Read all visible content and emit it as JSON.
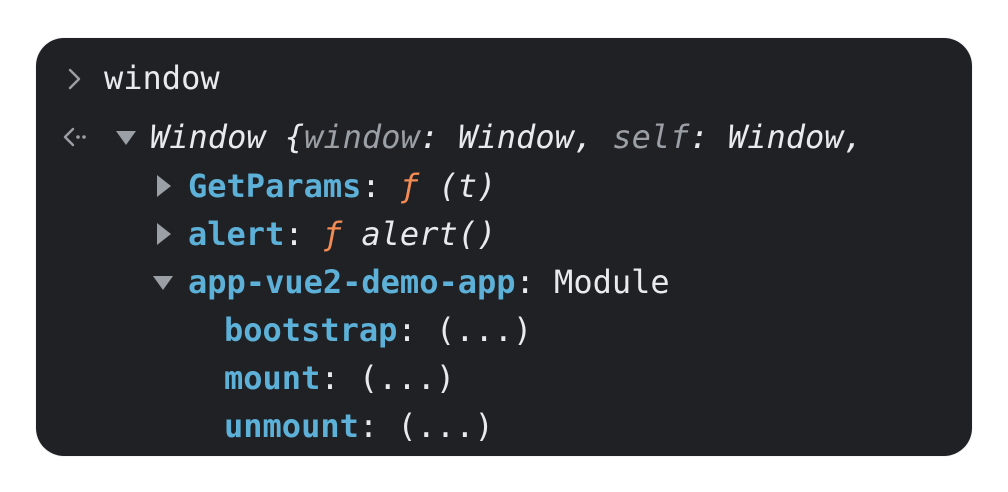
{
  "console": {
    "input": {
      "text": "window",
      "prompt_icon": "chevron-right-icon"
    },
    "result": {
      "result_icon": "return-arrow-icon",
      "expand_icon": "triangle-down-icon",
      "summary": {
        "prefix": "Window {",
        "k1": "window",
        "v1": ": Window, ",
        "k2": "self",
        "v2": ": Window,"
      }
    },
    "properties": [
      {
        "key": "GetParams",
        "sep": ": ",
        "fn": "ƒ",
        "value": " (t)",
        "expanded": false
      },
      {
        "key": "alert",
        "sep": ": ",
        "fn": "ƒ",
        "value": " alert()",
        "expanded": false
      },
      {
        "key": "app-vue2-demo-app",
        "sep": ": ",
        "value": "Module",
        "expanded": true
      }
    ],
    "module_properties": [
      {
        "key": "bootstrap",
        "sep": ": ",
        "value": "(...)"
      },
      {
        "key": "mount",
        "sep": ": ",
        "value": "(...)"
      },
      {
        "key": "unmount",
        "sep": ": ",
        "value": "(...)"
      }
    ],
    "colors": {
      "background": "#202124",
      "text": "#e8eaed",
      "dim": "#9aa0a6",
      "key": "#5db0d7",
      "function": "#f28b54"
    }
  }
}
